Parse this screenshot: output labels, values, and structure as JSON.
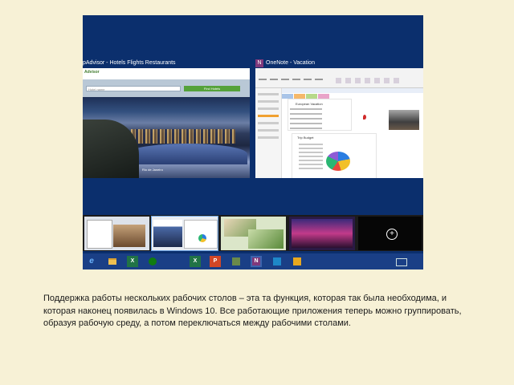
{
  "screenshot": {
    "window_left_title": "pAdvisor - Hotels Flights Restaurants",
    "window_right_title": "OneNote - Vacation",
    "onenote_icon_letter": "N",
    "tripadvisor": {
      "logo": "Advisor",
      "search_placeholder": "Hotel name",
      "search_button": "Find Hotels",
      "photo_caption": "Rio de Janeiro"
    },
    "onenote": {
      "page_title": "European Vacation",
      "budget_title": "Trip Budget"
    },
    "new_desktop_symbol": "+",
    "taskbar_icons": [
      "ie-icon",
      "file-explorer-icon",
      "excel-icon",
      "xbox-icon",
      "excel-icon",
      "powerpoint-icon",
      "maps-icon",
      "onenote-icon",
      "photos-icon",
      "sticky-icon"
    ],
    "taskbar_letters": [
      "e",
      "",
      "X",
      "",
      "X",
      "P",
      "",
      "N",
      "",
      ""
    ],
    "colors": {
      "desktop": "#0b2f6d",
      "taskbar": "#1a3f86",
      "onenote": "#80397b",
      "excel": "#217346",
      "powerpoint": "#d24726",
      "ie": "#3c8dde"
    }
  },
  "caption": "Поддержка работы нескольких рабочих столов – эта та функция, которая так была необходима, и которая наконец появилась в Windows 10. Все работающие приложения теперь можно группировать, образуя рабочую среду, а потом переключаться между рабочими столами."
}
